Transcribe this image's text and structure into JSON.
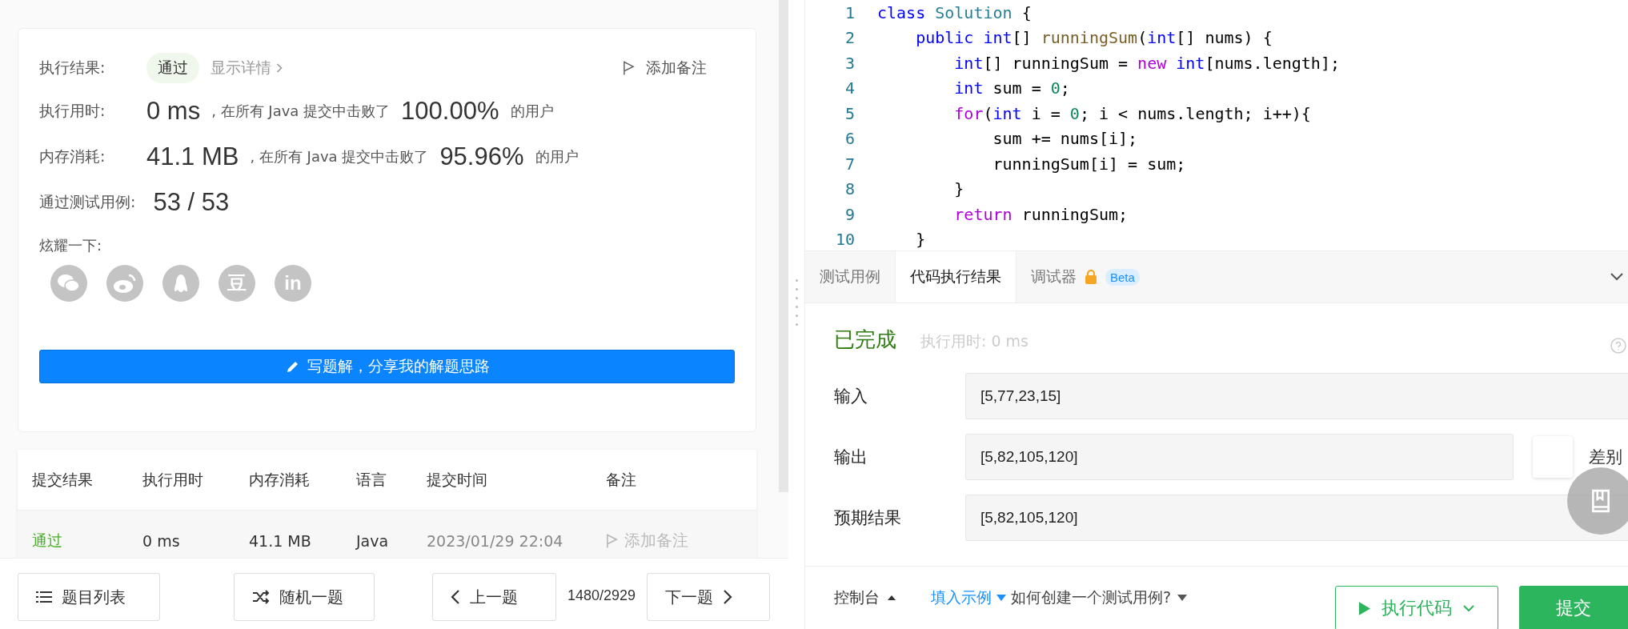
{
  "result_card": {
    "status_label": "执行结果:",
    "status": "通过",
    "details_link": "显示详情",
    "add_note": "添加备注",
    "stats": [
      {
        "label": "执行用时:",
        "value": "0 ms",
        "middle": ", 在所有 Java 提交中击败了",
        "percent": "100.00%",
        "suffix": "的用户"
      },
      {
        "label": "内存消耗:",
        "value": "41.1 MB",
        "middle": ", 在所有 Java 提交中击败了",
        "percent": "95.96%",
        "suffix": "的用户"
      }
    ],
    "tests_label": "通过测试用例:",
    "tests_value": "53 / 53",
    "share_label": "炫耀一下:",
    "share_icons": [
      {
        "kind": "wechat"
      },
      {
        "kind": "weibo"
      },
      {
        "kind": "qq"
      },
      {
        "kind": "douban",
        "text": "豆"
      },
      {
        "kind": "linkedin",
        "text": "in"
      }
    ],
    "write_button": "写题解，分享我的解题思路"
  },
  "submissions": {
    "columns": [
      "提交结果",
      "执行用时",
      "内存消耗",
      "语言",
      "提交时间",
      "备注"
    ],
    "rows": [
      {
        "result": "通过",
        "time": "0 ms",
        "memory": "41.1 MB",
        "language": "Java",
        "submitted": "2023/01/29 22:04",
        "note": "添加备注"
      }
    ]
  },
  "nav": {
    "list_button": "题目列表",
    "random_button": "随机一题",
    "prev_button": "上一题",
    "counter": "1480/2929",
    "next_button": "下一题"
  },
  "code": [
    {
      "number": "1",
      "tokens": [
        {
          "text": "class ",
          "kind": "kw"
        },
        {
          "text": "Solution ",
          "kind": "type"
        },
        {
          "text": "{",
          "kind": "plain"
        }
      ]
    },
    {
      "number": "2",
      "tokens": [
        {
          "text": "    public ",
          "kind": "kw"
        },
        {
          "text": "int",
          "kind": "kw"
        },
        {
          "text": "[] ",
          "kind": "plain"
        },
        {
          "text": "runningSum",
          "kind": "fn"
        },
        {
          "text": "(",
          "kind": "plain"
        },
        {
          "text": "int",
          "kind": "kw"
        },
        {
          "text": "[] nums) {",
          "kind": "plain"
        }
      ]
    },
    {
      "number": "3",
      "tokens": [
        {
          "text": "        int",
          "kind": "kw"
        },
        {
          "text": "[] runningSum = ",
          "kind": "plain"
        },
        {
          "text": "new ",
          "kind": "ctl"
        },
        {
          "text": "int",
          "kind": "kw"
        },
        {
          "text": "[nums.length];",
          "kind": "plain"
        }
      ]
    },
    {
      "number": "4",
      "tokens": [
        {
          "text": "        int ",
          "kind": "kw"
        },
        {
          "text": "sum = ",
          "kind": "plain"
        },
        {
          "text": "0",
          "kind": "num"
        },
        {
          "text": ";",
          "kind": "plain"
        }
      ]
    },
    {
      "number": "5",
      "tokens": [
        {
          "text": "        for",
          "kind": "ctl"
        },
        {
          "text": "(",
          "kind": "plain"
        },
        {
          "text": "int ",
          "kind": "kw"
        },
        {
          "text": "i = ",
          "kind": "plain"
        },
        {
          "text": "0",
          "kind": "num"
        },
        {
          "text": "; i < nums.length; i++){",
          "kind": "plain"
        }
      ]
    },
    {
      "number": "6",
      "tokens": [
        {
          "text": "            sum += nums[i];",
          "kind": "plain"
        }
      ]
    },
    {
      "number": "7",
      "tokens": [
        {
          "text": "            runningSum[i] = sum;",
          "kind": "plain"
        }
      ]
    },
    {
      "number": "8",
      "tokens": [
        {
          "text": "        }",
          "kind": "plain"
        }
      ]
    },
    {
      "number": "9",
      "tokens": [
        {
          "text": "        return ",
          "kind": "ctl"
        },
        {
          "text": "runningSum;",
          "kind": "plain"
        }
      ]
    },
    {
      "number": "10",
      "tokens": [
        {
          "text": "    }",
          "kind": "plain"
        }
      ]
    }
  ],
  "console_tabs": [
    {
      "label": "测试用例",
      "selected": false
    },
    {
      "label": "代码执行结果",
      "selected": true
    },
    {
      "label": "调试器",
      "selected": false,
      "locked": true,
      "badge": "Beta"
    }
  ],
  "run_result": {
    "status": "已完成",
    "elapsed": "执行用时: 0 ms",
    "fields": [
      {
        "label": "输入",
        "value": "[5,77,23,15]"
      },
      {
        "label": "输出",
        "value": "[5,82,105,120]",
        "diff_label": "差别"
      },
      {
        "label": "预期结果",
        "value": "[5,82,105,120]"
      }
    ]
  },
  "footer": {
    "console": "控制台",
    "fill_example": "填入示例",
    "how_to": "如何创建一个测试用例?",
    "run_button": "执行代码",
    "submit_button": "提交"
  }
}
